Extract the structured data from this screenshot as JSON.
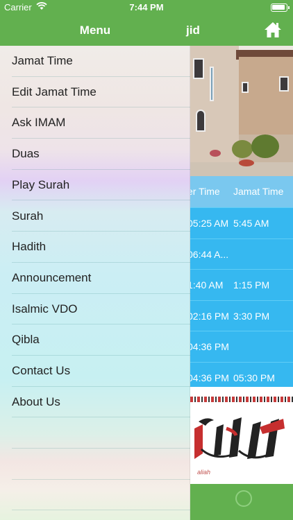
{
  "status_bar": {
    "carrier": "Carrier",
    "time": "7:44 PM"
  },
  "nav": {
    "menu_title": "Menu",
    "page_title_fragment": "jid",
    "home_icon": "home-icon"
  },
  "menu": {
    "items": [
      {
        "label": "Jamat Time"
      },
      {
        "label": "Edit Jamat Time"
      },
      {
        "label": "Ask IMAM"
      },
      {
        "label": "Duas"
      },
      {
        "label": "Play Surah"
      },
      {
        "label": "Surah"
      },
      {
        "label": "Hadith"
      },
      {
        "label": "Announcement"
      },
      {
        "label": "Isalmic VDO"
      },
      {
        "label": "Qibla"
      },
      {
        "label": "Contact Us"
      },
      {
        "label": "About Us"
      }
    ]
  },
  "prayer_table": {
    "headers": [
      "er Time",
      "Jamat Time"
    ],
    "rows": [
      [
        "05:25 AM",
        "5:45 AM"
      ],
      [
        "06:44 A...",
        ""
      ],
      [
        "1:40 AM",
        "1:15 PM"
      ],
      [
        "02:16 PM",
        "3:30 PM"
      ],
      [
        "04:36 PM",
        ""
      ],
      [
        "04:36 PM",
        "05:30 PM"
      ]
    ]
  },
  "banner": {
    "subtitle": "aliah"
  },
  "colors": {
    "brand_green": "#62b04f",
    "header_blue": "#7ac8ef",
    "row_blue": "#36b8f0"
  }
}
